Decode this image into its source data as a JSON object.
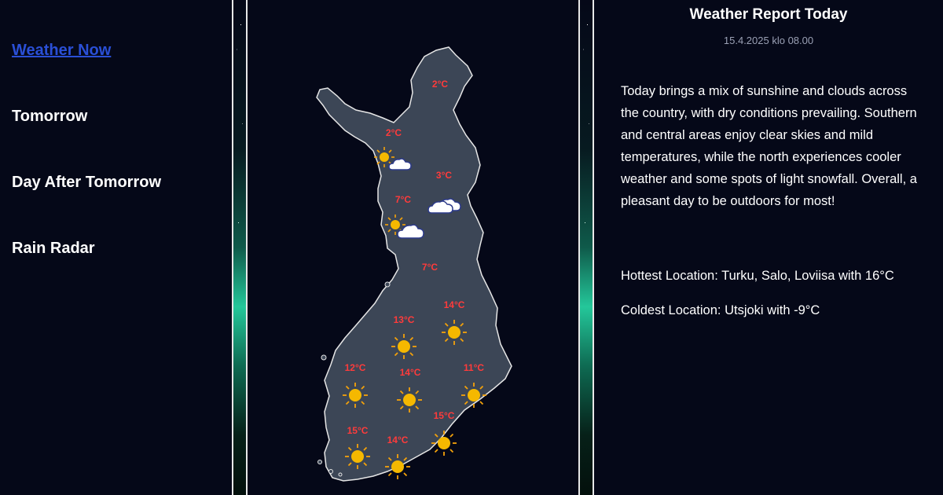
{
  "nav": {
    "items": [
      {
        "label": "Weather Now",
        "active": true
      },
      {
        "label": "Tomorrow",
        "active": false
      },
      {
        "label": "Day After Tomorrow",
        "active": false
      },
      {
        "label": "Rain Radar",
        "active": false
      }
    ]
  },
  "map": {
    "land_color": "#3c4656",
    "outline_color": "#e6e6e6",
    "temp_color": "#ff3b3b",
    "temperatures": [
      "2°C",
      "2°C",
      "3°C",
      "7°C",
      "7°C",
      "14°C",
      "13°C",
      "12°C",
      "14°C",
      "11°C",
      "15°C",
      "15°C",
      "14°C"
    ],
    "weather_icons": [
      "sun-cloud-icon",
      "cloud-icon",
      "sun-cloud-icon",
      "sun-icon",
      "sun-icon",
      "sun-icon",
      "sun-icon",
      "sun-icon",
      "sun-icon",
      "sun-icon",
      "sun-icon"
    ]
  },
  "report": {
    "title": "Weather Report Today",
    "date": "15.4.2025 klo 08.00",
    "summary": "Today brings a mix of sunshine and clouds across the country, with dry conditions prevailing. Southern and central areas enjoy clear skies and mild temperatures, while the north experiences cooler weather and some spots of light snowfall. Overall, a pleasant day to be outdoors for most!",
    "hottest": "Hottest Location: Turku, Salo, Loviisa with 16°C",
    "coldest": "Coldest Location: Utsjoki with -9°C"
  }
}
